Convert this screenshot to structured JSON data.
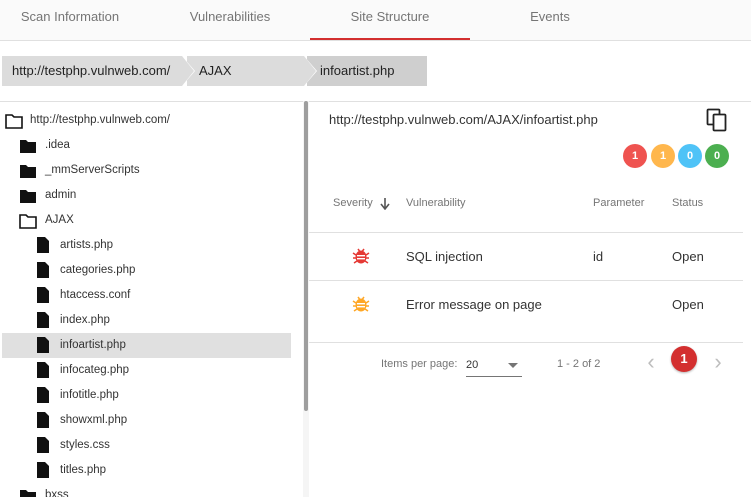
{
  "tabs": [
    {
      "label": "Scan Information"
    },
    {
      "label": "Vulnerabilities"
    },
    {
      "label": "Site Structure",
      "active": true
    },
    {
      "label": "Events"
    }
  ],
  "breadcrumb": [
    "http://testphp.vulnweb.com/",
    "AJAX",
    "infoartist.php"
  ],
  "tree": [
    {
      "label": "http://testphp.vulnweb.com/",
      "type": "folder-open",
      "level": 0
    },
    {
      "label": ".idea",
      "type": "folder",
      "level": 1
    },
    {
      "label": "_mmServerScripts",
      "type": "folder",
      "level": 1
    },
    {
      "label": "admin",
      "type": "folder",
      "level": 1
    },
    {
      "label": "AJAX",
      "type": "folder-open",
      "level": 1
    },
    {
      "label": "artists.php",
      "type": "file",
      "level": 2
    },
    {
      "label": "categories.php",
      "type": "file",
      "level": 2
    },
    {
      "label": "htaccess.conf",
      "type": "file",
      "level": 2
    },
    {
      "label": "index.php",
      "type": "file",
      "level": 2
    },
    {
      "label": "infoartist.php",
      "type": "file",
      "level": 2,
      "selected": true
    },
    {
      "label": "infocateg.php",
      "type": "file",
      "level": 2
    },
    {
      "label": "infotitle.php",
      "type": "file",
      "level": 2
    },
    {
      "label": "showxml.php",
      "type": "file",
      "level": 2
    },
    {
      "label": "styles.css",
      "type": "file",
      "level": 2
    },
    {
      "label": "titles.php",
      "type": "file",
      "level": 2
    },
    {
      "label": "bxss",
      "type": "folder",
      "level": 1
    }
  ],
  "detail": {
    "url": "http://testphp.vulnweb.com/AJAX/infoartist.php",
    "badges": [
      {
        "value": "1",
        "color": "#ef5350"
      },
      {
        "value": "1",
        "color": "#ffb74d"
      },
      {
        "value": "0",
        "color": "#4fc3f7"
      },
      {
        "value": "0",
        "color": "#4caf50"
      }
    ]
  },
  "table": {
    "headers": {
      "severity": "Severity",
      "vulnerability": "Vulnerability",
      "parameter": "Parameter",
      "status": "Status"
    },
    "rows": [
      {
        "severity_color": "#e53935",
        "vulnerability": "SQL injection",
        "parameter": "id",
        "status": "Open"
      },
      {
        "severity_color": "#ffa726",
        "vulnerability": "Error message on page",
        "parameter": "",
        "status": "Open"
      }
    ]
  },
  "pager": {
    "items_label": "Items per page:",
    "items_per_page": "20",
    "range": "1 - 2 of 2",
    "current_page": "1"
  },
  "icons": {
    "prev": "‹",
    "next": "›"
  }
}
